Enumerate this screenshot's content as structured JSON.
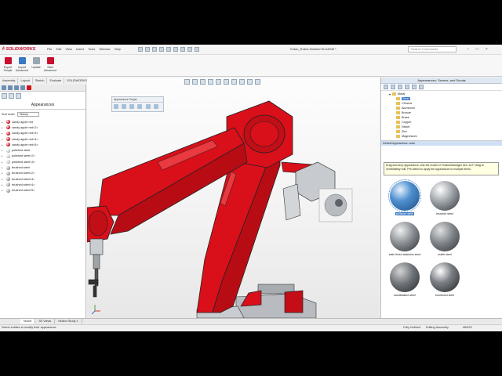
{
  "app": {
    "logo": "SOLIDWORKS",
    "document_title": "Kofan_Robot-finished.SLDASM *",
    "search_placeholder": "Search Commands",
    "window_controls": [
      "–",
      "□",
      "×"
    ]
  },
  "menu": [
    "File",
    "Edit",
    "View",
    "Insert",
    "Tools",
    "Window",
    "Help"
  ],
  "ribbon": {
    "buttons": [
      {
        "label": "Export Simple",
        "icon": "export-icon",
        "color": "#c8102e"
      },
      {
        "label": "Import Advanced",
        "icon": "import-icon",
        "color": "#3a78c2"
      },
      {
        "label": "Update",
        "icon": "update-icon",
        "color": "#9aa6b2"
      },
      {
        "label": "Start Advanced",
        "icon": "start-icon",
        "color": "#c8102e"
      }
    ]
  },
  "command_tabs": [
    "Assembly",
    "Layout",
    "Sketch",
    "Evaluate",
    "SOLIDWORKS Add-Ins",
    "SOLIDWORKS Visualize"
  ],
  "left_panel": {
    "title": "Appearances",
    "sort_label": "Sort order",
    "sort_value": "History",
    "items": [
      {
        "label": "candy apple red",
        "color": "#d0121b"
      },
      {
        "label": "candy apple red<2>",
        "color": "#d0121b"
      },
      {
        "label": "candy apple red<3>",
        "color": "#d0121b"
      },
      {
        "label": "candy apple red<4>",
        "color": "#d0121b"
      },
      {
        "label": "candy apple red<5>",
        "color": "#d0121b"
      },
      {
        "label": "polished steel",
        "color": "#c8cdd2"
      },
      {
        "label": "polished steel<2>",
        "color": "#c8cdd2"
      },
      {
        "label": "polished steel<3>",
        "color": "#c8cdd2"
      },
      {
        "label": "brushed steel",
        "color": "#9ca3aa"
      },
      {
        "label": "brushed steel<2>",
        "color": "#9ca3aa"
      },
      {
        "label": "brushed steel<3>",
        "color": "#9ca3aa"
      },
      {
        "label": "brushed steel<4>",
        "color": "#9ca3aa"
      },
      {
        "label": "brushed steel<5>",
        "color": "#9ca3aa"
      }
    ]
  },
  "graphics": {
    "float_toolbar_title": "Appearance Target",
    "accent_red": "#d90f1a"
  },
  "right_pane": {
    "title": "Appearances, Scenes, and Decals",
    "tree": {
      "root": "Metal",
      "children": [
        "Steel",
        "Chrome",
        "Aluminum",
        "Bronze",
        "Brass",
        "Copper",
        "Nickel",
        "Zinc",
        "Magnesium"
      ],
      "selected": "Steel"
    },
    "selected_label": "Default Appearance: color",
    "tooltip": "Drag and drop appearance onto the model or FeatureManager tree. ALT+drag to immediately edit. Pre-select to apply the appearance to multiple items.",
    "swatches": [
      {
        "label": "polished steel",
        "selected": true
      },
      {
        "label": "brushed steel",
        "selected": false
      },
      {
        "label": "satin finish stainless steel",
        "selected": false
      },
      {
        "label": "matte steel",
        "selected": false
      },
      {
        "label": "sandblasted steel",
        "selected": false
      },
      {
        "label": "burnished steel",
        "selected": false
      }
    ]
  },
  "bottom_tabs": [
    "Model",
    "3D Views",
    "Motion Study 1"
  ],
  "status": {
    "left": "Select entities to modify their appearance",
    "defined": "Fully Defined",
    "editing": "Editing Assembly",
    "units": "MMGS"
  }
}
